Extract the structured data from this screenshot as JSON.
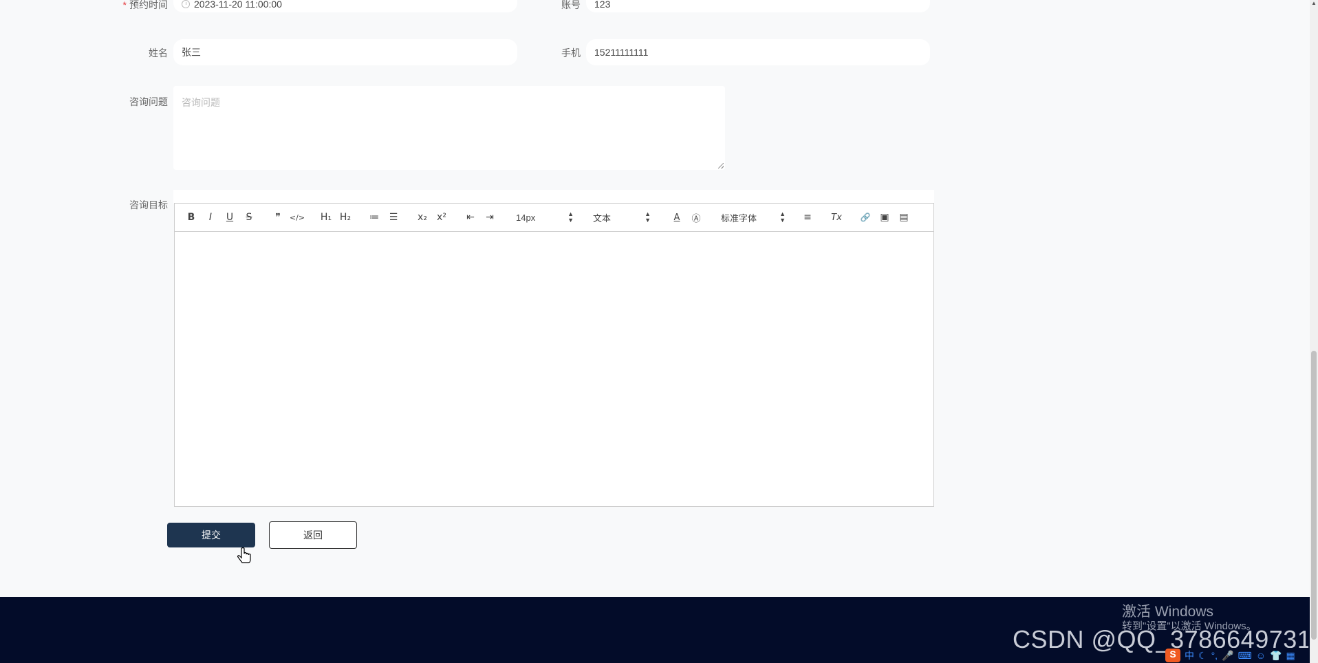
{
  "form": {
    "appointment_time": {
      "label": "预约时间",
      "required_mark": "*",
      "value": "2023-11-20 11:00:00"
    },
    "account": {
      "label": "账号",
      "value": "123"
    },
    "name": {
      "label": "姓名",
      "value": "张三"
    },
    "phone": {
      "label": "手机",
      "value": "15211111111"
    },
    "question": {
      "label": "咨询问题",
      "placeholder": "咨询问题"
    },
    "goal": {
      "label": "咨询目标"
    }
  },
  "editor": {
    "font_size": "14px",
    "header_picker": "文本",
    "font_family": "标准字体",
    "icons": {
      "bold": "B",
      "italic": "I",
      "underline": "U",
      "strike": "S",
      "quote": "❞",
      "code": "</>",
      "h1": "H₁",
      "h2": "H₂",
      "ordered_list": "≔",
      "bullet_list": "☰",
      "subscript": "x₂",
      "superscript": "x²",
      "indent_decrease": "⇤",
      "indent_increase": "⇥",
      "color": "A",
      "background": "Ⓐ",
      "align": "≡",
      "clean": "Tx",
      "link": "🔗",
      "image": "▣",
      "video": "▤"
    }
  },
  "buttons": {
    "submit": "提交",
    "back": "返回"
  },
  "watermark": {
    "title": "激活 Windows",
    "subtitle": "转到\"设置\"以激活 Windows。",
    "csdn": "CSDN @QQ_3786649731"
  },
  "tray": {
    "ime": "中",
    "icons": [
      "sogou-icon",
      "moon-icon",
      "punctuation-icon",
      "mic-icon",
      "keyboard-icon",
      "shirt-icon",
      "grid-icon"
    ]
  },
  "colors": {
    "primary": "#1e3550",
    "footer": "#030c29",
    "background": "#f8f9fa"
  }
}
